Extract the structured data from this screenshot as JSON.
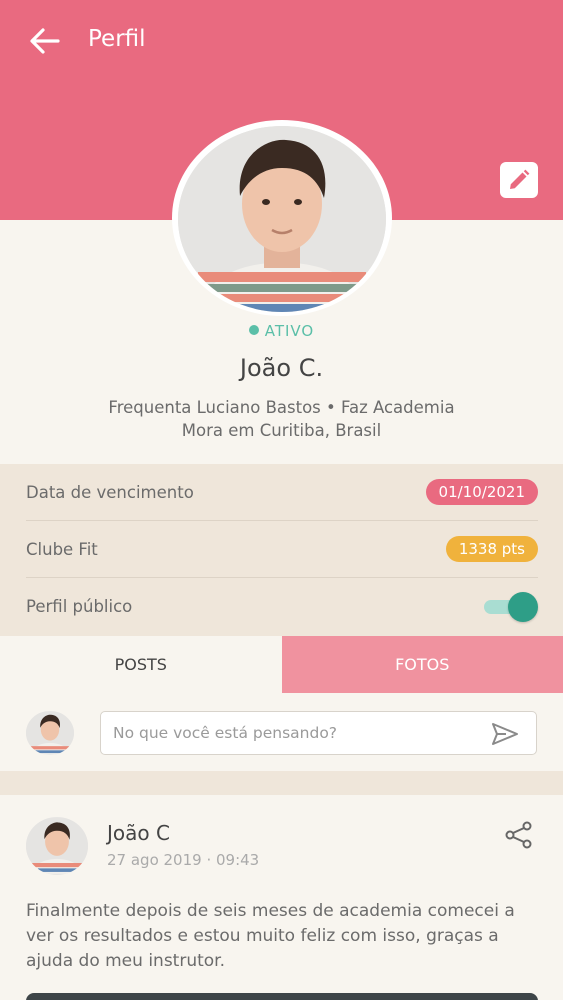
{
  "header": {
    "title": "Perfil",
    "back_icon": "arrow-left-icon",
    "edit_icon": "pencil-icon",
    "color": "#e96a80"
  },
  "profile": {
    "status": "ATIVO",
    "status_color": "#5bbfa8",
    "name": "João C.",
    "line1": "Frequenta Luciano Bastos • Faz Academia",
    "line2": "Mora em Curitiba, Brasil"
  },
  "info": {
    "due_label": "Data de vencimento",
    "due_value": "01/10/2021",
    "club_label": "Clube Fit",
    "club_value": "1338 pts",
    "public_label": "Perfil público",
    "public_on": true
  },
  "tabs": [
    {
      "label": "POSTS",
      "active": true
    },
    {
      "label": "FOTOS",
      "active": false
    }
  ],
  "composer": {
    "placeholder": "No que você está pensando?",
    "send_icon": "send-icon"
  },
  "post": {
    "author": "João C",
    "date": "27 ago 2019 · 09:43",
    "text": "Finalmente depois de seis meses de academia comecei a ver os resultados e estou muito feliz com isso, graças a ajuda do meu instrutor.",
    "share_icon": "share-icon"
  }
}
